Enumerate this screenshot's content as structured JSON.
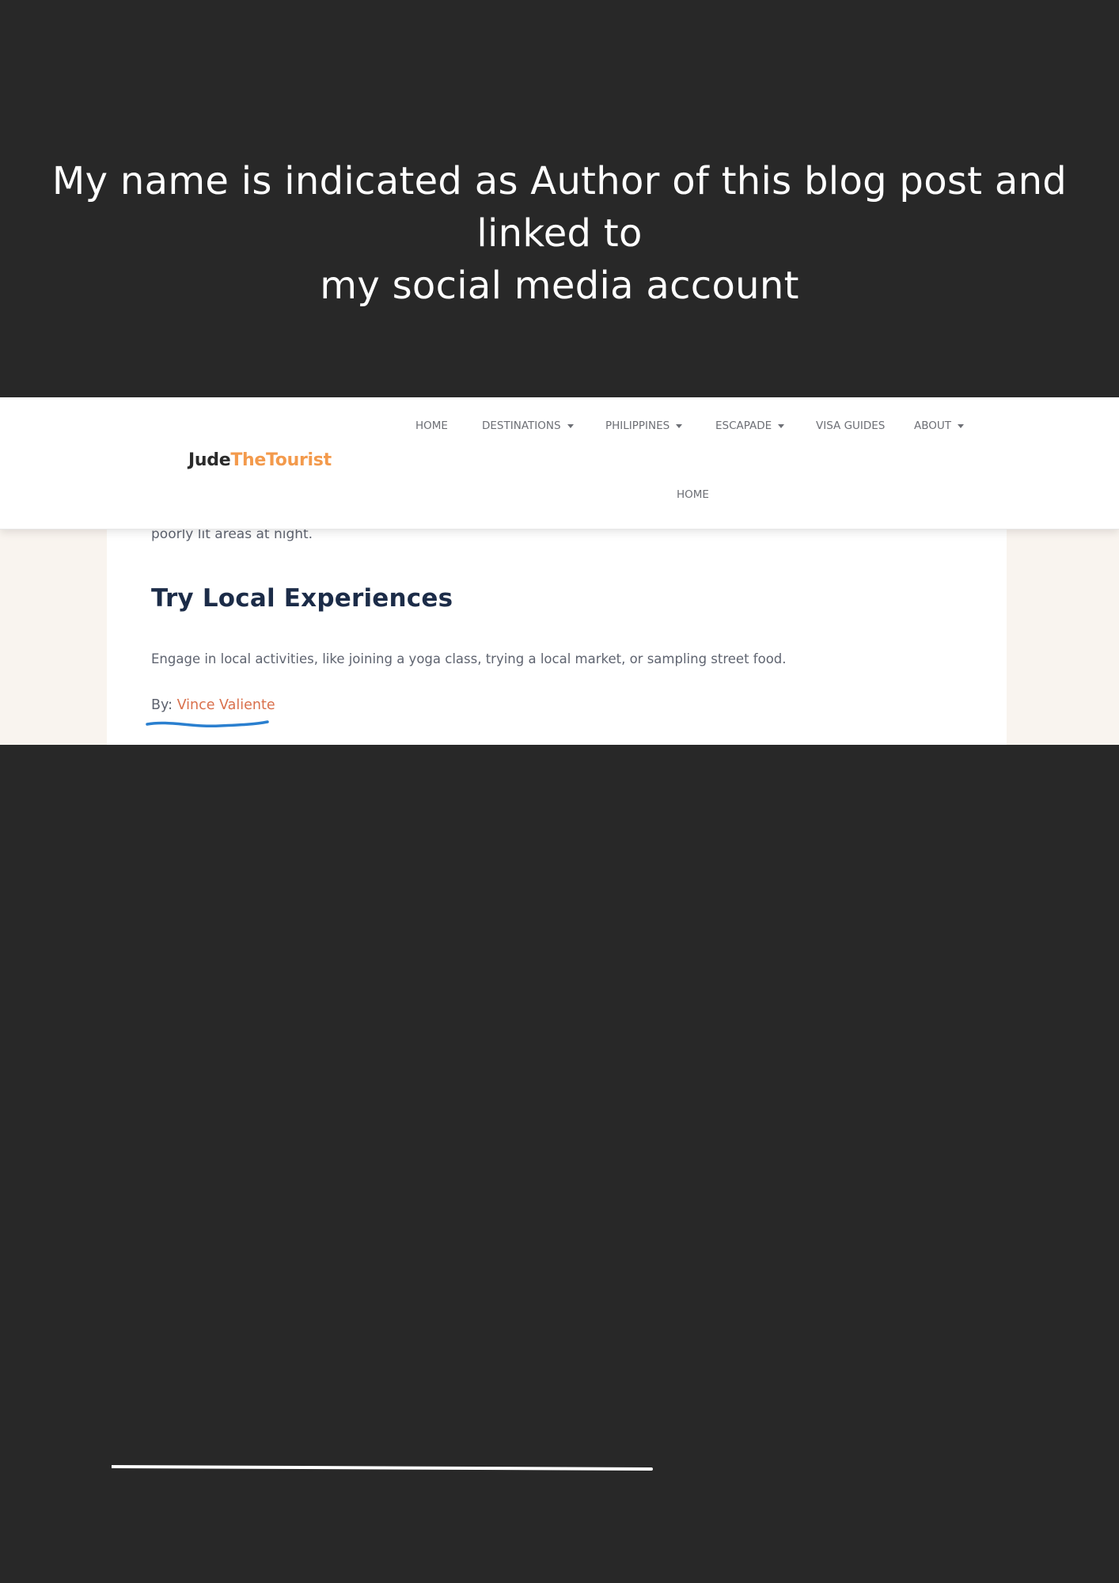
{
  "caption": {
    "line1": "My name is indicated as Author of this blog post and linked to",
    "line2": "my social media account"
  },
  "header": {
    "logo_part1": "Jude",
    "logo_part2": "TheTourist",
    "nav": [
      {
        "label": "HOME",
        "has_caret": false
      },
      {
        "label": "DESTINATIONS",
        "has_caret": true
      },
      {
        "label": "PHILIPPINES",
        "has_caret": true
      },
      {
        "label": "ESCAPADE",
        "has_caret": true
      },
      {
        "label": "VISA GUIDES",
        "has_caret": false
      },
      {
        "label": "ABOUT",
        "has_caret": true
      }
    ],
    "nav_row2": "HOME"
  },
  "article": {
    "fragment": "poorly lit areas at night.",
    "heading": "Try Local Experiences",
    "paragraph": "Engage in local activities, like joining a yoga class, trying a local market, or sampling street food.",
    "byline_prefix": "By: ",
    "author_name": "Vince Valiente"
  },
  "colors": {
    "background": "#282828",
    "accent_orange": "#f39a4c",
    "author_link": "#d9704c",
    "annotation_blue": "#2a7fcf",
    "heading_navy": "#1c2c48"
  }
}
